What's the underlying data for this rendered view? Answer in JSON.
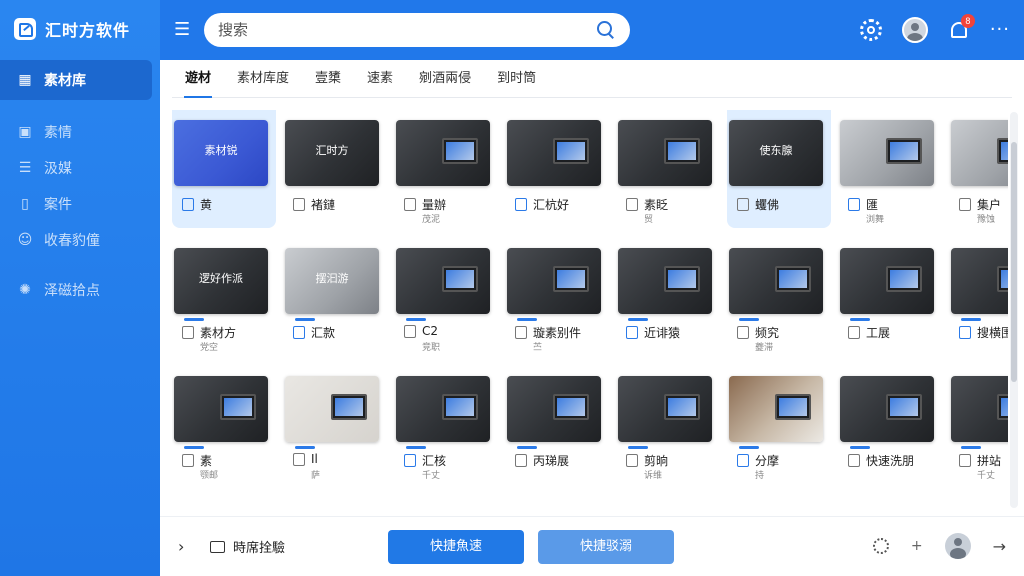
{
  "brand": {
    "name": "汇时方软件"
  },
  "sidebar": {
    "items": [
      {
        "label": "素材库",
        "icon": "folder-icon",
        "active": true
      },
      {
        "label": "素情",
        "icon": "image-icon"
      },
      {
        "label": "汲媒",
        "icon": "list-icon"
      },
      {
        "label": "案件",
        "icon": "phone-icon"
      },
      {
        "label": "收春豹僮",
        "icon": "user-icon"
      },
      {
        "label": "泽磁拾点",
        "icon": "gear-icon"
      }
    ]
  },
  "header": {
    "search_placeholder": "搜索",
    "notification_count": "8"
  },
  "tabs": [
    "遊材",
    "素材库度",
    "壹橥",
    "速素",
    "剜酒兩侵",
    "到时筒"
  ],
  "cards": [
    {
      "label": "黄",
      "thumb": "blue",
      "caption": "素材锐",
      "selected": true
    },
    {
      "label": "褚鏈",
      "thumb": "dark",
      "caption": "汇时方"
    },
    {
      "label": "量辦",
      "thumb": "dark",
      "sub": "茂泥"
    },
    {
      "label": "汇杭好",
      "thumb": "dark"
    },
    {
      "label": "素眨",
      "thumb": "dark",
      "sub": "贸"
    },
    {
      "label": "蠼佛",
      "thumb": "dark",
      "caption": "使东腺",
      "selected": true
    },
    {
      "label": "匯",
      "thumb": "light",
      "sub": "浏舞"
    },
    {
      "label": "集户",
      "thumb": "light",
      "sub": "豫蚀"
    },
    {
      "label": "素材方",
      "thumb": "dark",
      "caption": "逻好作派",
      "sub": "党空"
    },
    {
      "label": "汇款",
      "thumb": "light",
      "caption": "摆汩游"
    },
    {
      "label": "C2",
      "thumb": "dark",
      "sub": "竞职"
    },
    {
      "label": "璇素别件",
      "thumb": "dark",
      "sub": "苎"
    },
    {
      "label": "近诽猿",
      "thumb": "dark"
    },
    {
      "label": "频究",
      "thumb": "dark",
      "sub": "夔滞"
    },
    {
      "label": "工展",
      "thumb": "dark"
    },
    {
      "label": "搜横围",
      "thumb": "dark"
    },
    {
      "label": "素",
      "thumb": "dark",
      "sub": "颚邮"
    },
    {
      "label": "Il",
      "thumb": "paper",
      "sub": "萨"
    },
    {
      "label": "汇核",
      "thumb": "dark",
      "sub": "千丈"
    },
    {
      "label": "丙珶展",
      "thumb": "dark"
    },
    {
      "label": "剪晌",
      "thumb": "dark",
      "sub": "诉维"
    },
    {
      "label": "分摩",
      "thumb": "wood",
      "sub": "持"
    },
    {
      "label": "快速洗朋",
      "thumb": "dark"
    },
    {
      "label": "拼站",
      "thumb": "dark",
      "sub": "千丈"
    }
  ],
  "footer": {
    "folder_label": "時席拴驗",
    "primary_button": "快捷魚速",
    "secondary_button": "快捷驳溺"
  },
  "colors": {
    "accent": "#2179e6",
    "sidebar": "#2a86f0",
    "badge": "#f0433a"
  }
}
